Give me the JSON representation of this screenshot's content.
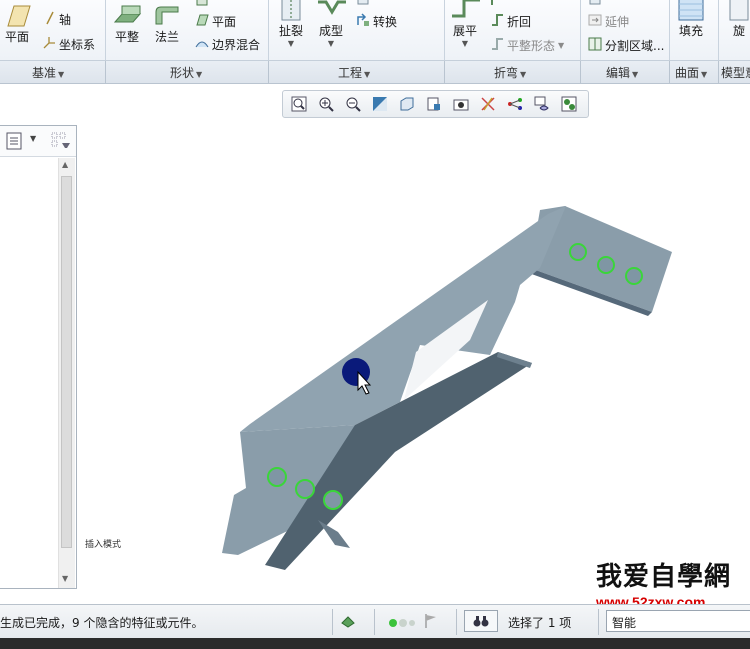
{
  "ribbon": {
    "datum": {
      "plane": "平面",
      "axis": "轴",
      "csys": "坐标系"
    },
    "shapes": {
      "flat": "平整",
      "flange": "法兰",
      "plane": "平面",
      "boundary_blend": "边界混合"
    },
    "engineering": {
      "rip": "扯裂",
      "form": "成型",
      "convert": "转换"
    },
    "bends": {
      "unbend": "展平",
      "bend_back": "折回",
      "flat_state": "平整形态"
    },
    "editing": {
      "extend": "延伸",
      "split_area": "分割区域..."
    },
    "surfaces": {
      "fill": "填充"
    }
  },
  "groups": {
    "datum": "基准",
    "shapes": "形状",
    "engineering": "工程",
    "bends": "折弯",
    "editing": "编辑",
    "surfaces": "曲面",
    "model_intent": "模型意"
  },
  "view_toolbar": {
    "icons": [
      "refit-icon",
      "zoom-in-icon",
      "zoom-out-icon",
      "repaint-icon",
      "display-style-icon",
      "saved-views-icon",
      "view-manager-icon",
      "datum-display-icon",
      "spin-center-icon",
      "annotation-display-icon",
      "render-icon"
    ]
  },
  "canvas": {
    "insert_mode": "插入模式"
  },
  "watermark": {
    "title": "我爱自學網",
    "url": "www.52zxw.com"
  },
  "status": {
    "message": "生成已完成，9 个隐含的特征或元件。",
    "selected": "选择了 1 项",
    "filter": "智能"
  },
  "colors": {
    "part": "#8a9daa",
    "part_dark": "#56697a",
    "hole": "#3ad63a",
    "cursor_dot": "#0a1a7a"
  }
}
